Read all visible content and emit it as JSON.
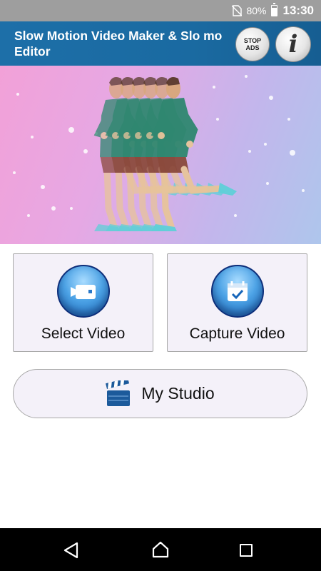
{
  "status_bar": {
    "battery_percent": "80%",
    "time": "13:30",
    "battery_level": 0.8
  },
  "header": {
    "title": "Slow Motion Video Maker & Slo mo Editor",
    "stop_ads_line1": "STOP",
    "stop_ads_line2": "ADS",
    "info_glyph": "i"
  },
  "actions": {
    "select_video": {
      "label": "Select Video",
      "icon": "video-camera-icon"
    },
    "capture_video": {
      "label": "Capture Video",
      "icon": "calendar-check-icon"
    }
  },
  "studio": {
    "label": "My Studio",
    "icon": "clapperboard-icon"
  },
  "nav": {
    "back_icon": "back-icon",
    "home_icon": "home-icon",
    "recent_icon": "recent-apps-icon"
  },
  "colors": {
    "app_bar": "#1d6fa8",
    "status_bar": "#9e9e9e",
    "card_bg": "#f4f1f9",
    "accent_blue": "#1665b9"
  }
}
